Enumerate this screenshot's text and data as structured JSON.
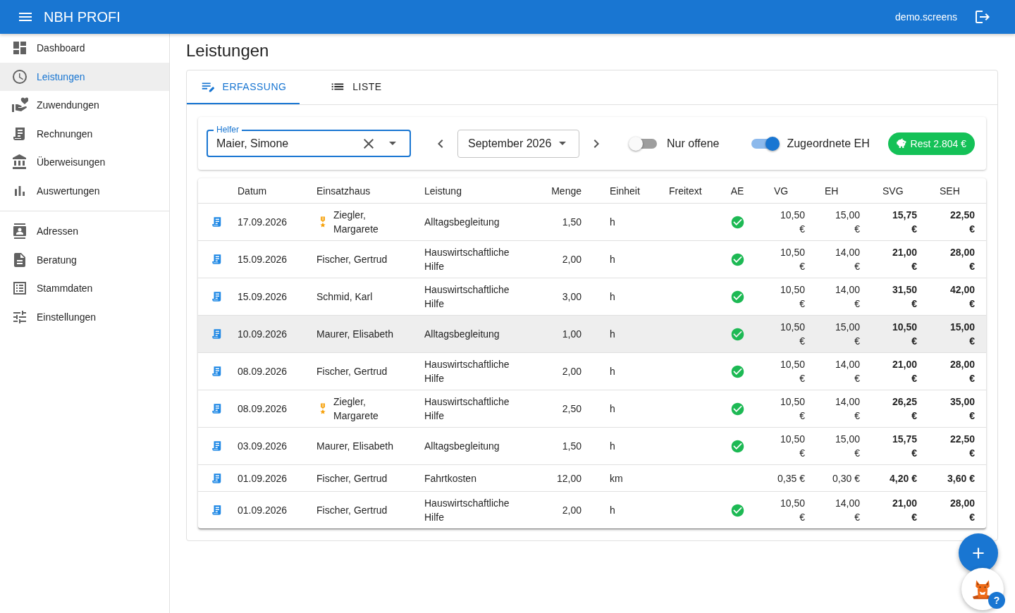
{
  "app": {
    "title": "NBH PROFI",
    "user": "demo.screens"
  },
  "nav_sections": [
    {
      "items": [
        {
          "label": "Dashboard",
          "selected": false
        },
        {
          "label": "Leistungen",
          "selected": true
        },
        {
          "label": "Zuwendungen",
          "selected": false
        },
        {
          "label": "Rechnungen",
          "selected": false
        },
        {
          "label": "Überweisungen",
          "selected": false
        },
        {
          "label": "Auswertungen",
          "selected": false
        }
      ]
    },
    {
      "items": [
        {
          "label": "Adressen",
          "selected": false
        },
        {
          "label": "Beratung",
          "selected": false
        },
        {
          "label": "Stammdaten",
          "selected": false
        },
        {
          "label": "Einstellungen",
          "selected": false
        }
      ]
    }
  ],
  "page_title": "Leistungen",
  "tabs": [
    {
      "label": "ERFASSUNG",
      "selected": true
    },
    {
      "label": "LISTE",
      "selected": false
    }
  ],
  "filter": {
    "helper": {
      "label": "Helfer",
      "value": "Maier, Simone"
    },
    "month": "September 2026",
    "only_open": {
      "label": "Nur offene",
      "on": false
    },
    "assigned": {
      "label": "Zugeordnete EH",
      "on": true
    },
    "rest": "Rest 2.804 €"
  },
  "table": {
    "columns": [
      "Datum",
      "Einsatzhaus",
      "Leistung",
      "Menge",
      "Einheit",
      "Freitext",
      "AE",
      "VG",
      "EH",
      "SVG",
      "SEH"
    ],
    "rows": [
      {
        "date": "17.09.2026",
        "house": "Ziegler, Margarete",
        "award": true,
        "service": "Alltagsbegleitung",
        "quantity": "1,50",
        "unit": "h",
        "ae": true,
        "vg": "10,50 €",
        "eh": "15,00 €",
        "svg": "15,75 €",
        "seh": "22,50 €",
        "selected": false
      },
      {
        "date": "15.09.2026",
        "house": "Fischer, Gertrud",
        "award": false,
        "service": "Hauswirtschaftliche Hilfe",
        "quantity": "2,00",
        "unit": "h",
        "ae": true,
        "vg": "10,50 €",
        "eh": "14,00 €",
        "svg": "21,00 €",
        "seh": "28,00 €",
        "selected": false
      },
      {
        "date": "15.09.2026",
        "house": "Schmid, Karl",
        "award": false,
        "service": "Hauswirtschaftliche Hilfe",
        "quantity": "3,00",
        "unit": "h",
        "ae": true,
        "vg": "10,50 €",
        "eh": "14,00 €",
        "svg": "31,50 €",
        "seh": "42,00 €",
        "selected": false
      },
      {
        "date": "10.09.2026",
        "house": "Maurer, Elisabeth",
        "award": false,
        "service": "Alltagsbegleitung",
        "quantity": "1,00",
        "unit": "h",
        "ae": true,
        "vg": "10,50 €",
        "eh": "15,00 €",
        "svg": "10,50 €",
        "seh": "15,00 €",
        "selected": true
      },
      {
        "date": "08.09.2026",
        "house": "Fischer, Gertrud",
        "award": false,
        "service": "Hauswirtschaftliche Hilfe",
        "quantity": "2,00",
        "unit": "h",
        "ae": true,
        "vg": "10,50 €",
        "eh": "14,00 €",
        "svg": "21,00 €",
        "seh": "28,00 €",
        "selected": false
      },
      {
        "date": "08.09.2026",
        "house": "Ziegler, Margarete",
        "award": true,
        "service": "Hauswirtschaftliche Hilfe",
        "quantity": "2,50",
        "unit": "h",
        "ae": true,
        "vg": "10,50 €",
        "eh": "14,00 €",
        "svg": "26,25 €",
        "seh": "35,00 €",
        "selected": false
      },
      {
        "date": "03.09.2026",
        "house": "Maurer, Elisabeth",
        "award": false,
        "service": "Alltagsbegleitung",
        "quantity": "1,50",
        "unit": "h",
        "ae": true,
        "vg": "10,50 €",
        "eh": "15,00 €",
        "svg": "15,75 €",
        "seh": "22,50 €",
        "selected": false
      },
      {
        "date": "01.09.2026",
        "house": "Fischer, Gertrud",
        "award": false,
        "service": "Fahrtkosten",
        "quantity": "12,00",
        "unit": "km",
        "ae": false,
        "vg": "0,35 €",
        "eh": "0,30 €",
        "svg": "4,20 €",
        "seh": "3,60 €",
        "selected": false
      },
      {
        "date": "01.09.2026",
        "house": "Fischer, Gertrud",
        "award": false,
        "service": "Hauswirtschaftliche Hilfe",
        "quantity": "2,00",
        "unit": "h",
        "ae": true,
        "vg": "10,50 €",
        "eh": "14,00 €",
        "svg": "21,00 €",
        "seh": "28,00 €",
        "selected": false
      }
    ]
  },
  "help_badge": "?"
}
